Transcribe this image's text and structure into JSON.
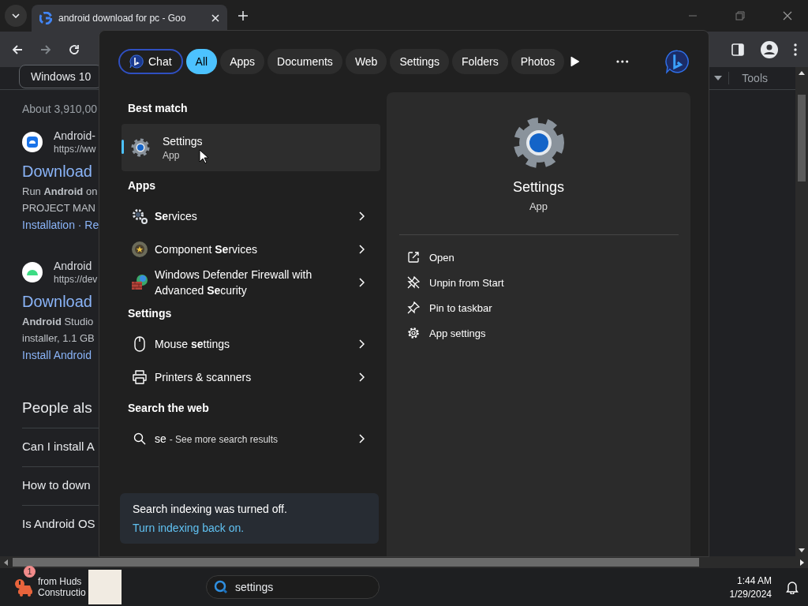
{
  "browser": {
    "tab": {
      "title": "android download for pc - Goo"
    }
  },
  "page": {
    "chip": "Windows 10",
    "result_stats": "About 3,910,00",
    "results": [
      {
        "site": "Android-",
        "url": "https://ww",
        "title": "Download",
        "snippet": [
          "Run **Android** on",
          "PROJECT MAN"
        ],
        "links": "Installation · Re"
      },
      {
        "site": "Android",
        "url": "https://dev",
        "title": "Download",
        "snippet": [
          "**Android** Studio",
          "installer, 1.1 GB"
        ],
        "links": "Install Android"
      }
    ],
    "people_also_ask": {
      "heading": "People als",
      "questions": [
        "Can I install A",
        "How to down",
        "Is Android OS"
      ]
    },
    "tools": "Tools"
  },
  "search_flyout": {
    "filters": [
      {
        "kind": "chat",
        "label": "Chat",
        "selected": false
      },
      {
        "kind": "filter",
        "label": "All",
        "selected": true
      },
      {
        "kind": "filter",
        "label": "Apps",
        "selected": false
      },
      {
        "kind": "filter",
        "label": "Documents",
        "selected": false
      },
      {
        "kind": "filter",
        "label": "Web",
        "selected": false
      },
      {
        "kind": "filter",
        "label": "Settings",
        "selected": false
      },
      {
        "kind": "filter",
        "label": "Folders",
        "selected": false
      },
      {
        "kind": "filter",
        "label": "Photos",
        "selected": false
      }
    ],
    "best_match": {
      "heading": "Best match",
      "title": "Settings",
      "subtitle": "App",
      "selected": true
    },
    "sections": [
      {
        "kind": "apps",
        "heading": "Apps",
        "items": [
          {
            "label": "**Se**rvices"
          },
          {
            "label": "Component **Se**rvices"
          },
          {
            "label": "Windows Defender Firewall with Advanced **Se**curity"
          }
        ]
      },
      {
        "kind": "settings",
        "heading": "Settings",
        "items": [
          {
            "label": "Mouse **se**ttings"
          },
          {
            "label": "Printers & scanners"
          }
        ]
      },
      {
        "kind": "web",
        "heading": "Search the web",
        "items": [
          {
            "query": "se",
            "label": "- See more search results"
          }
        ]
      }
    ],
    "notice": {
      "text": "Search indexing was turned off.",
      "link": "Turn indexing back on."
    },
    "preview": {
      "title": "Settings",
      "subtitle": "App",
      "actions": [
        "Open",
        "Unpin from Start",
        "Pin to taskbar",
        "App settings"
      ]
    }
  },
  "taskbar": {
    "widget": {
      "badge": "1",
      "line1": "from Huds",
      "line2": "Constructio"
    },
    "search": {
      "value": "settings"
    },
    "clock": {
      "time": "1:44 AM",
      "date": "1/29/2024"
    }
  }
}
